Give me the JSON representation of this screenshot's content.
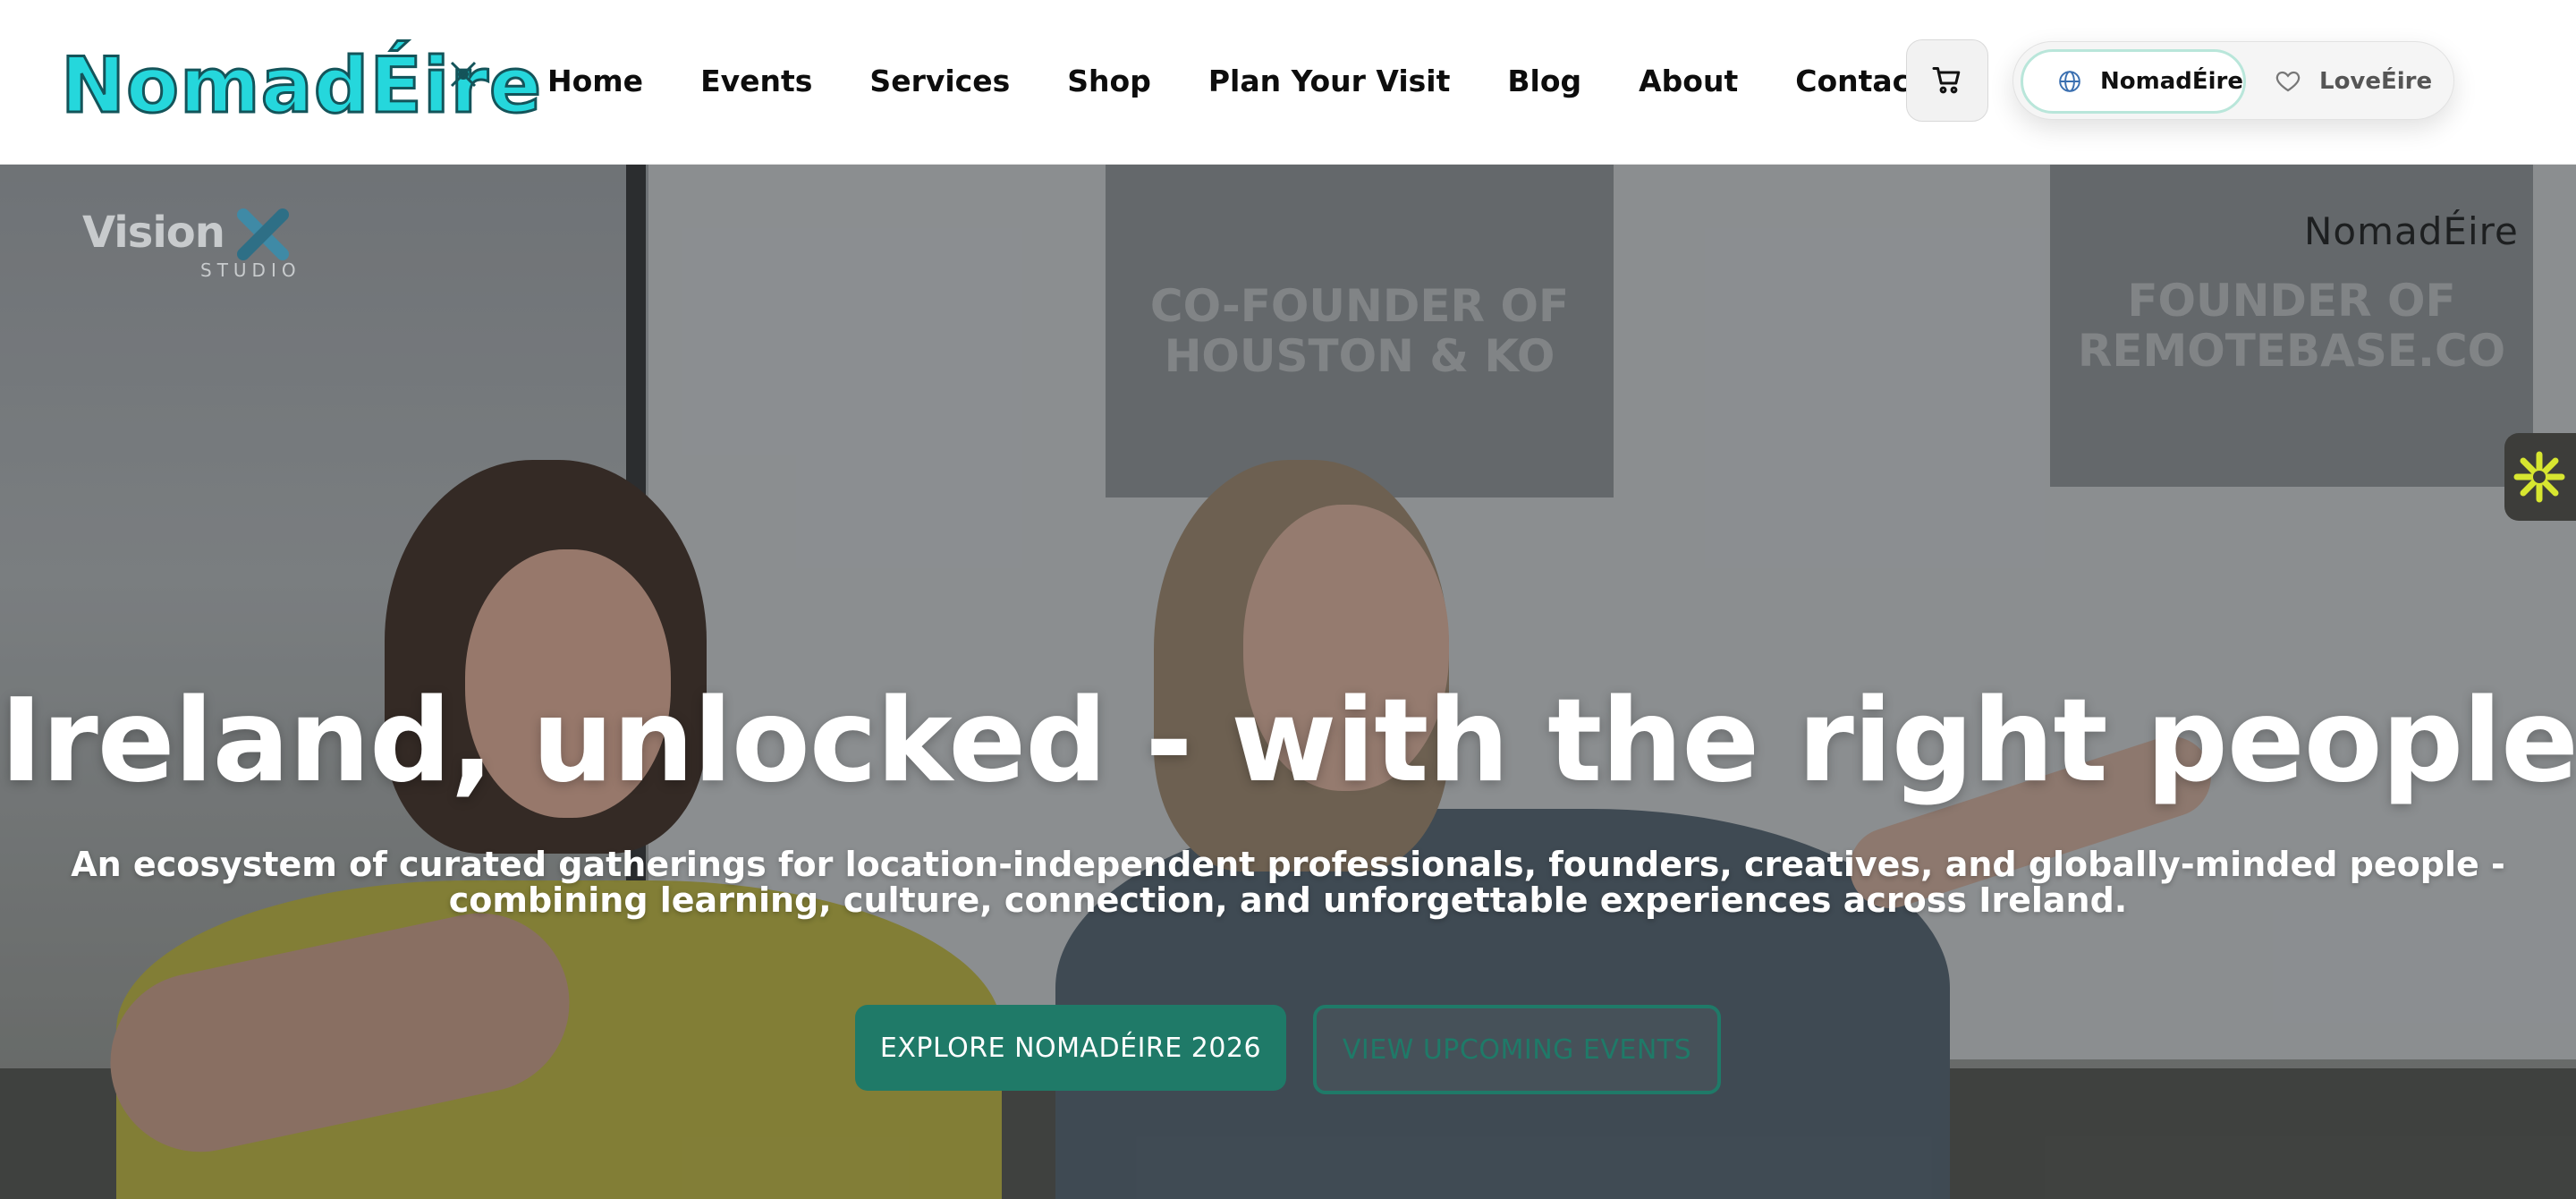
{
  "header": {
    "logo_text": "NomadÉire",
    "nav": [
      "Home",
      "Events",
      "Services",
      "Shop",
      "Plan Your Visit",
      "Blog",
      "About",
      "Contact"
    ],
    "cart_icon": "cart-icon",
    "site_toggle": {
      "active_label": "NomadÉire",
      "active_icon": "globe-icon",
      "inactive_label": "LoveÉire",
      "inactive_icon": "heart-icon"
    }
  },
  "hero": {
    "image_logo_left": "Vision",
    "image_logo_left_sub": "STUDIO",
    "image_logo_right": "NomadÉire",
    "banner_1": "CO-FOUNDER OF HOUSTON & KO",
    "banner_2": "FOUNDER OF REMOTEBASE.CO",
    "title": "Ireland, unlocked - with the right people.",
    "subtitle": "An ecosystem of curated gatherings for location-independent professionals, founders, creatives, and globally-minded people - combining learning, culture, connection, and unforgettable experiences across Ireland.",
    "primary_cta": "EXPLORE NOMADÉIRE 2026",
    "secondary_cta": "VIEW UPCOMING EVENTS"
  },
  "colors": {
    "brand_cyan": "#25d7dc",
    "brand_teal": "#1f7a68",
    "widget_yellow": "#d7e630"
  }
}
